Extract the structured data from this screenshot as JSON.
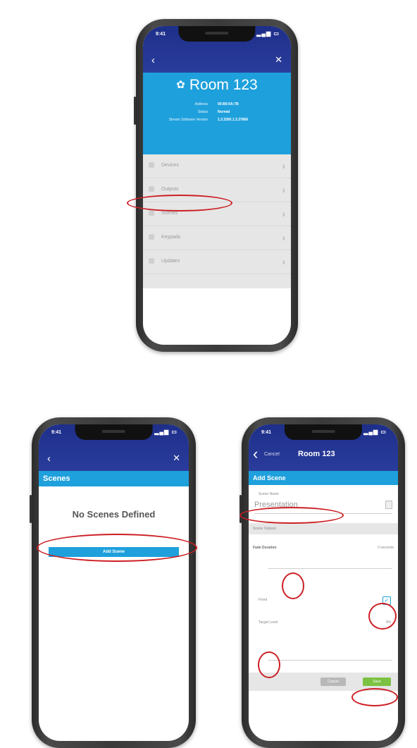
{
  "phone1": {
    "status": {
      "time": "9:41"
    },
    "title": "Room 123",
    "info": [
      {
        "label": "Address",
        "value": "00:B0:0A:7B"
      },
      {
        "label": "Status",
        "value": "Normal"
      },
      {
        "label": "Stream Software Version",
        "value": "1.3.3260.1.3.37866"
      }
    ],
    "menu": [
      "Devices",
      "Outputs",
      "Scenes",
      "Keypads",
      "Updates"
    ]
  },
  "phone2": {
    "status": {
      "time": "9:41"
    },
    "header": "Scenes",
    "empty_text": "No Scenes Defined",
    "add_button": "Add Scene"
  },
  "phone3": {
    "status": {
      "time": "9:41"
    },
    "cancel": "Cancel",
    "title": "Room 123",
    "section": "Add Scene",
    "scene_name_label": "Scene Name",
    "scene_name_value": "Presentation",
    "band_label": "Scene Outputs",
    "fade_label": "Fade Duration",
    "fade_unit": "0 seconds",
    "fixed_label": "Fixed",
    "target_label": "Target Level",
    "target_unit": "0%",
    "cancel_btn": "Cancel",
    "save_btn": "Save"
  },
  "colors": {
    "nav": "#1e2f8a",
    "accent": "#1ea0dc",
    "highlight": "#cc1f24",
    "save": "#7cc242"
  }
}
